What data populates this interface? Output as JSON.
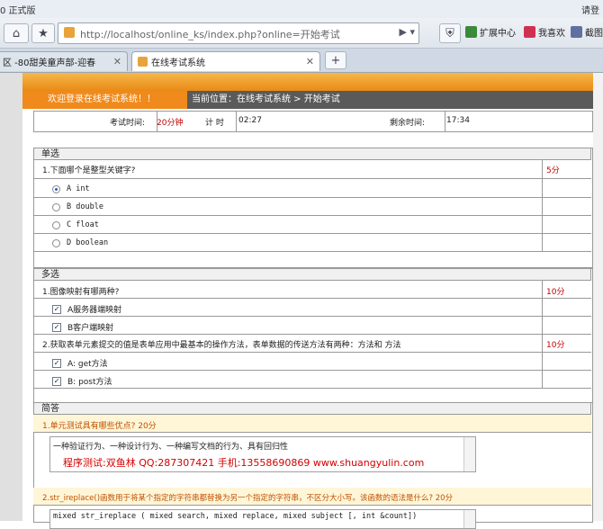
{
  "browser": {
    "title": "0 正式版",
    "user": "请登",
    "address": "http://localhost/online_ks/index.php?online=开始考试",
    "tools": [
      "扩展中心",
      "我喜欢",
      "截图"
    ],
    "tabs": [
      {
        "label": "区 -80甜美童声部-迎春"
      },
      {
        "label": "在线考试系统"
      }
    ]
  },
  "header": {
    "welcome": "欢迎登录在线考试系统！！",
    "location": "当前位置：在线考试系统 > 开始考试"
  },
  "timer": {
    "exam_time_label": "考试时间:",
    "exam_time_value": "20分钟",
    "elapsed_label": "计 时",
    "elapsed_value": "02:27",
    "remaining_label": "剩余时间:",
    "remaining_value": "17:34"
  },
  "single": {
    "title": "单选",
    "question": "1.下面哪个是整型关键字?",
    "score": "5分",
    "options": [
      "A int",
      "B double",
      "C float",
      "D boolean"
    ],
    "selected_index": 0
  },
  "multi": {
    "title": "多选",
    "questions": [
      {
        "text": "1.图像映射有哪两种?",
        "score": "10分",
        "options": [
          "A服务器端映射",
          "B客户端映射"
        ],
        "checked": [
          true,
          true
        ]
      },
      {
        "text": "2.获取表单元素提交的值是表单应用中最基本的操作方法，表单数据的传送方法有两种：方法和 方法",
        "score": "10分",
        "options": [
          "A: get方法",
          "B: post方法"
        ],
        "checked": [
          true,
          true
        ]
      }
    ]
  },
  "essay": {
    "title": "简答",
    "q1": "1.单元测试具有哪些优点?   20分",
    "a1_line1": "一种验证行为、一种设计行为、一种编写文档的行为、具有回归性",
    "a1_line2": "程序测试:双鱼林 QQ:287307421 手机:13558690869 www.shuangyulin.com",
    "q2": "2.str_ireplace()函数用于将某个指定的字符串都替换为另一个指定的字符串，不区分大小写。该函数的语法是什么?   20分",
    "a2_line1": "mixed str_ireplace ( mixed search, mixed replace, mixed subject [, int &count])"
  },
  "colors": {
    "banner": "#e98a16",
    "welcome_bg": "#f08a1c",
    "score": "#c00000",
    "watermark": "#d40000"
  }
}
